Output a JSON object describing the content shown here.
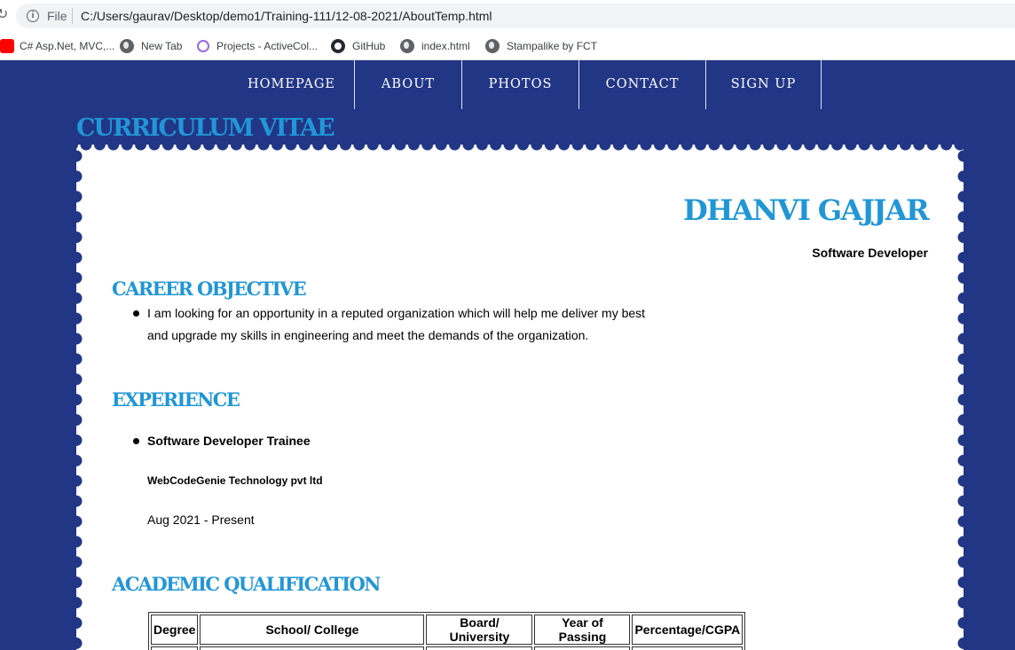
{
  "browser": {
    "scheme_label": "File",
    "url": "C:/Users/gaurav/Desktop/demo1/Training-111/12-08-2021/AboutTemp.html",
    "bookmarks": [
      {
        "label": "C# Asp.Net, MVC,...",
        "icon": "youtube-icon"
      },
      {
        "label": "New Tab",
        "icon": "globe-icon"
      },
      {
        "label": "Projects - ActiveCol...",
        "icon": "projects-icon"
      },
      {
        "label": "GitHub",
        "icon": "github-icon"
      },
      {
        "label": "index.html",
        "icon": "globe-icon"
      },
      {
        "label": "Stampalike by FCT",
        "icon": "globe-icon"
      }
    ]
  },
  "nav": {
    "items": [
      "HOMEPAGE",
      "ABOUT",
      "PHOTOS",
      "CONTACT",
      "SIGN UP"
    ]
  },
  "page": {
    "section_title": "CURRICULUM VITAE",
    "name": "DHANVI GAJJAR",
    "role": "Software Developer",
    "career_objective": {
      "heading": "CAREER OBJECTIVE",
      "text": "I am looking for an opportunity in a reputed organization which will help me deliver my best and upgrade my skills in engineering and meet the demands of the organization."
    },
    "experience": {
      "heading": "EXPERIENCE",
      "title": "Software Developer Trainee",
      "company": "WebCodeGenie Technology pvt ltd",
      "dates": "Aug 2021 - Present"
    },
    "academic": {
      "heading": "ACADEMIC QUALIFICATION",
      "columns": [
        "Degree",
        "School/ College",
        "Board/ University",
        "Year of Passing",
        "Percentage/CGPA"
      ]
    }
  },
  "colors": {
    "page_background": "#223686",
    "heading_blue": "#2196d6",
    "paper": "#ffffff"
  }
}
